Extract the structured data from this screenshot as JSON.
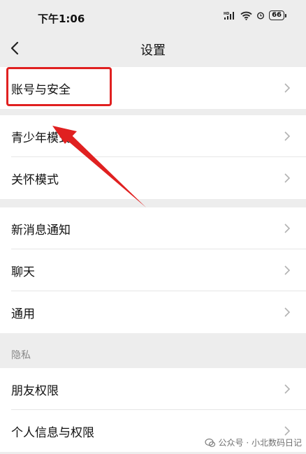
{
  "status_bar": {
    "time": "下午1:06",
    "battery": "66",
    "icons": [
      "hd-signal-icon",
      "wifi-icon",
      "alarm-icon",
      "battery-icon"
    ]
  },
  "nav": {
    "title": "设置",
    "back_icon": "chevron-left-icon"
  },
  "groups": [
    {
      "items": [
        {
          "label": "账号与安全"
        }
      ]
    },
    {
      "items": [
        {
          "label": "青少年模式"
        },
        {
          "label": "关怀模式"
        }
      ]
    },
    {
      "items": [
        {
          "label": "新消息通知"
        },
        {
          "label": "聊天"
        },
        {
          "label": "通用"
        }
      ]
    },
    {
      "header": "隐私",
      "items": [
        {
          "label": "朋友权限"
        },
        {
          "label": "个人信息与权限"
        }
      ]
    }
  ],
  "watermark": {
    "text": "公众号 · 小北数码日记"
  },
  "annotation": {
    "color": "#e02020"
  }
}
